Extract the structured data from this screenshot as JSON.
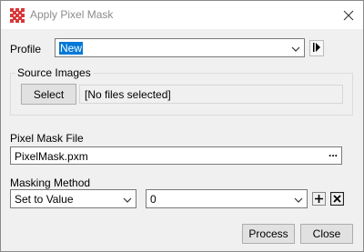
{
  "window": {
    "title": "Apply Pixel Mask"
  },
  "profile": {
    "label": "Profile",
    "value": "New"
  },
  "source_images": {
    "group_label": "Source Images",
    "select_label": "Select",
    "files_text": "[No files selected]"
  },
  "pixel_mask_file": {
    "label": "Pixel Mask File",
    "value": "PixelMask.pxm",
    "browse_label": "..."
  },
  "masking_method": {
    "label": "Masking Method",
    "method_value": "Set to Value",
    "value": "0"
  },
  "footer": {
    "process_label": "Process",
    "close_label": "Close"
  },
  "icons": {
    "app": "mask-grid-icon",
    "close": "close-icon",
    "run": "play-icon",
    "add": "plus-icon",
    "remove": "x-icon"
  },
  "colors": {
    "accent": "#0078d7",
    "app_icon": "#d9383a"
  }
}
